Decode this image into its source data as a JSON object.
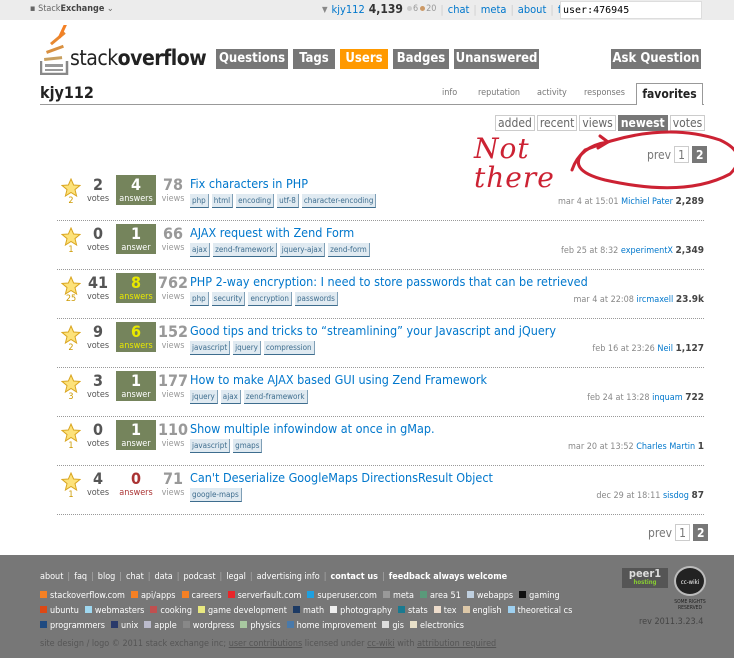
{
  "topbar": {
    "network": "Stack",
    "network_bold": "Exchange",
    "user": "kjy112",
    "rep": "4,139",
    "silver": "6",
    "bronze": "20",
    "links": [
      "chat",
      "meta",
      "about",
      "faq"
    ],
    "search_value": "user:476945"
  },
  "logo": {
    "light": "stack",
    "bold": "overflow"
  },
  "nav": [
    "Questions",
    "Tags",
    "Users",
    "Badges",
    "Unanswered"
  ],
  "ask": "Ask Question",
  "profile": {
    "username": "kjy112",
    "tabs": [
      "info",
      "reputation",
      "activity",
      "responses"
    ],
    "active_tab": "favorites"
  },
  "sorts": [
    "added",
    "recent",
    "views",
    "newest",
    "votes"
  ],
  "sort_selected": "newest",
  "pager": {
    "prev": "prev",
    "pages": [
      "1",
      "2"
    ],
    "current": "2"
  },
  "annotation": {
    "text": "Not there",
    "color": "#cc2233"
  },
  "labels": {
    "votes": "votes",
    "answers": "answers",
    "answer": "answer",
    "views": "views"
  },
  "questions": [
    {
      "fav": "2",
      "votes": "2",
      "answers": "4",
      "anslabel": "answers",
      "views": "78",
      "title": "Fix characters in PHP",
      "tags": [
        "php",
        "html",
        "encoding",
        "utf-8",
        "character-encoding"
      ],
      "time": "mar 4 at 15:01",
      "user": "Michiel Pater",
      "rep": "2,289",
      "state": "acc"
    },
    {
      "fav": "1",
      "votes": "0",
      "answers": "1",
      "anslabel": "answer",
      "views": "66",
      "title": "AJAX request with Zend Form",
      "tags": [
        "ajax",
        "zend-framework",
        "jquery-ajax",
        "zend-form"
      ],
      "time": "feb 25 at 8:32",
      "user": "experimentX",
      "rep": "2,349",
      "state": "acc"
    },
    {
      "fav": "25",
      "votes": "41",
      "answers": "8",
      "anslabel": "answers",
      "views": "762",
      "title": "PHP 2-way encryption: I need to store passwords that can be retrieved",
      "tags": [
        "php",
        "security",
        "encryption",
        "passwords"
      ],
      "time": "mar 4 at 22:08",
      "user": "ircmaxell",
      "rep": "23.9k",
      "state": "acc hot"
    },
    {
      "fav": "2",
      "votes": "9",
      "answers": "6",
      "anslabel": "answers",
      "views": "152",
      "title": "Good tips and tricks to “streamlining” your Javascript and jQuery",
      "tags": [
        "javascript",
        "jquery",
        "compression"
      ],
      "time": "feb 16 at 23:26",
      "user": "Neil",
      "rep": "1,127",
      "state": "acc hot"
    },
    {
      "fav": "3",
      "votes": "3",
      "answers": "1",
      "anslabel": "answer",
      "views": "177",
      "title": "How to make AJAX based GUI using Zend Framework",
      "tags": [
        "jquery",
        "ajax",
        "zend-framework"
      ],
      "time": "feb 24 at 13:28",
      "user": "inquam",
      "rep": "722",
      "state": "acc"
    },
    {
      "fav": "1",
      "votes": "0",
      "answers": "1",
      "anslabel": "answer",
      "views": "110",
      "title": "Show multiple infowindow at once in gMap.",
      "tags": [
        "javascript",
        "gmaps"
      ],
      "time": "mar 20 at 13:52",
      "user": "Charles Martin",
      "rep": "1",
      "state": "acc"
    },
    {
      "fav": "1",
      "votes": "4",
      "answers": "0",
      "anslabel": "answers",
      "views": "71",
      "title": "Can't Deserialize GoogleMaps DirectionsResult Object",
      "tags": [
        "google-maps"
      ],
      "time": "dec 29 at 18:11",
      "user": "sisdog",
      "rep": "87",
      "state": "zero"
    }
  ],
  "footer": {
    "links": [
      "about",
      "faq",
      "blog",
      "chat",
      "data",
      "podcast",
      "legal",
      "advertising info",
      "contact us",
      "feedback always welcome"
    ],
    "sites": [
      [
        "stackoverflow.com",
        "#f48024"
      ],
      [
        "api/apps",
        "#f48024"
      ],
      [
        "careers",
        "#f48024"
      ],
      [
        "serverfault.com",
        "#e8262a"
      ],
      [
        "superuser.com",
        "#1ea0e0"
      ],
      [
        "meta",
        "#999999"
      ],
      [
        "area 51",
        "#5a9a7a"
      ],
      [
        "webapps",
        "#c0d0e0"
      ],
      [
        "gaming",
        "#111111"
      ],
      [
        "ubuntu",
        "#dd4814"
      ],
      [
        "webmasters",
        "#9fd8f0"
      ],
      [
        "cooking",
        "#c05050"
      ],
      [
        "game development",
        "#e8e880"
      ],
      [
        "math",
        "#1c3a64"
      ],
      [
        "photography",
        "#eeeeee"
      ],
      [
        "stats",
        "#1a7a90"
      ],
      [
        "tex",
        "#eeddcc"
      ],
      [
        "english",
        "#ddc8a8"
      ],
      [
        "theoretical cs",
        "#9ed0f0"
      ],
      [
        "programmers",
        "#1f4a80"
      ],
      [
        "unix",
        "#2a3a6a"
      ],
      [
        "apple",
        "#bbbbcc"
      ],
      [
        "wordpress",
        "#888888"
      ],
      [
        "physics",
        "#a8c8a0"
      ],
      [
        "home improvement",
        "#4a7aaa"
      ],
      [
        "gis",
        "#dddddd"
      ],
      [
        "electronics",
        "#e8e0c8"
      ]
    ],
    "copyright": "site design / logo © 2011 stack exchange inc;",
    "contrib": "user contributions",
    "licensed": "licensed under",
    "ccwiki": "cc-wiki",
    "with": "with",
    "attribution": "attribution required",
    "peer1": "peer1",
    "hosting": "hosting",
    "cc_badge": "cc-wiki",
    "rights": "SOME RIGHTS RESERVED",
    "rev": "rev 2011.3.23.4"
  }
}
